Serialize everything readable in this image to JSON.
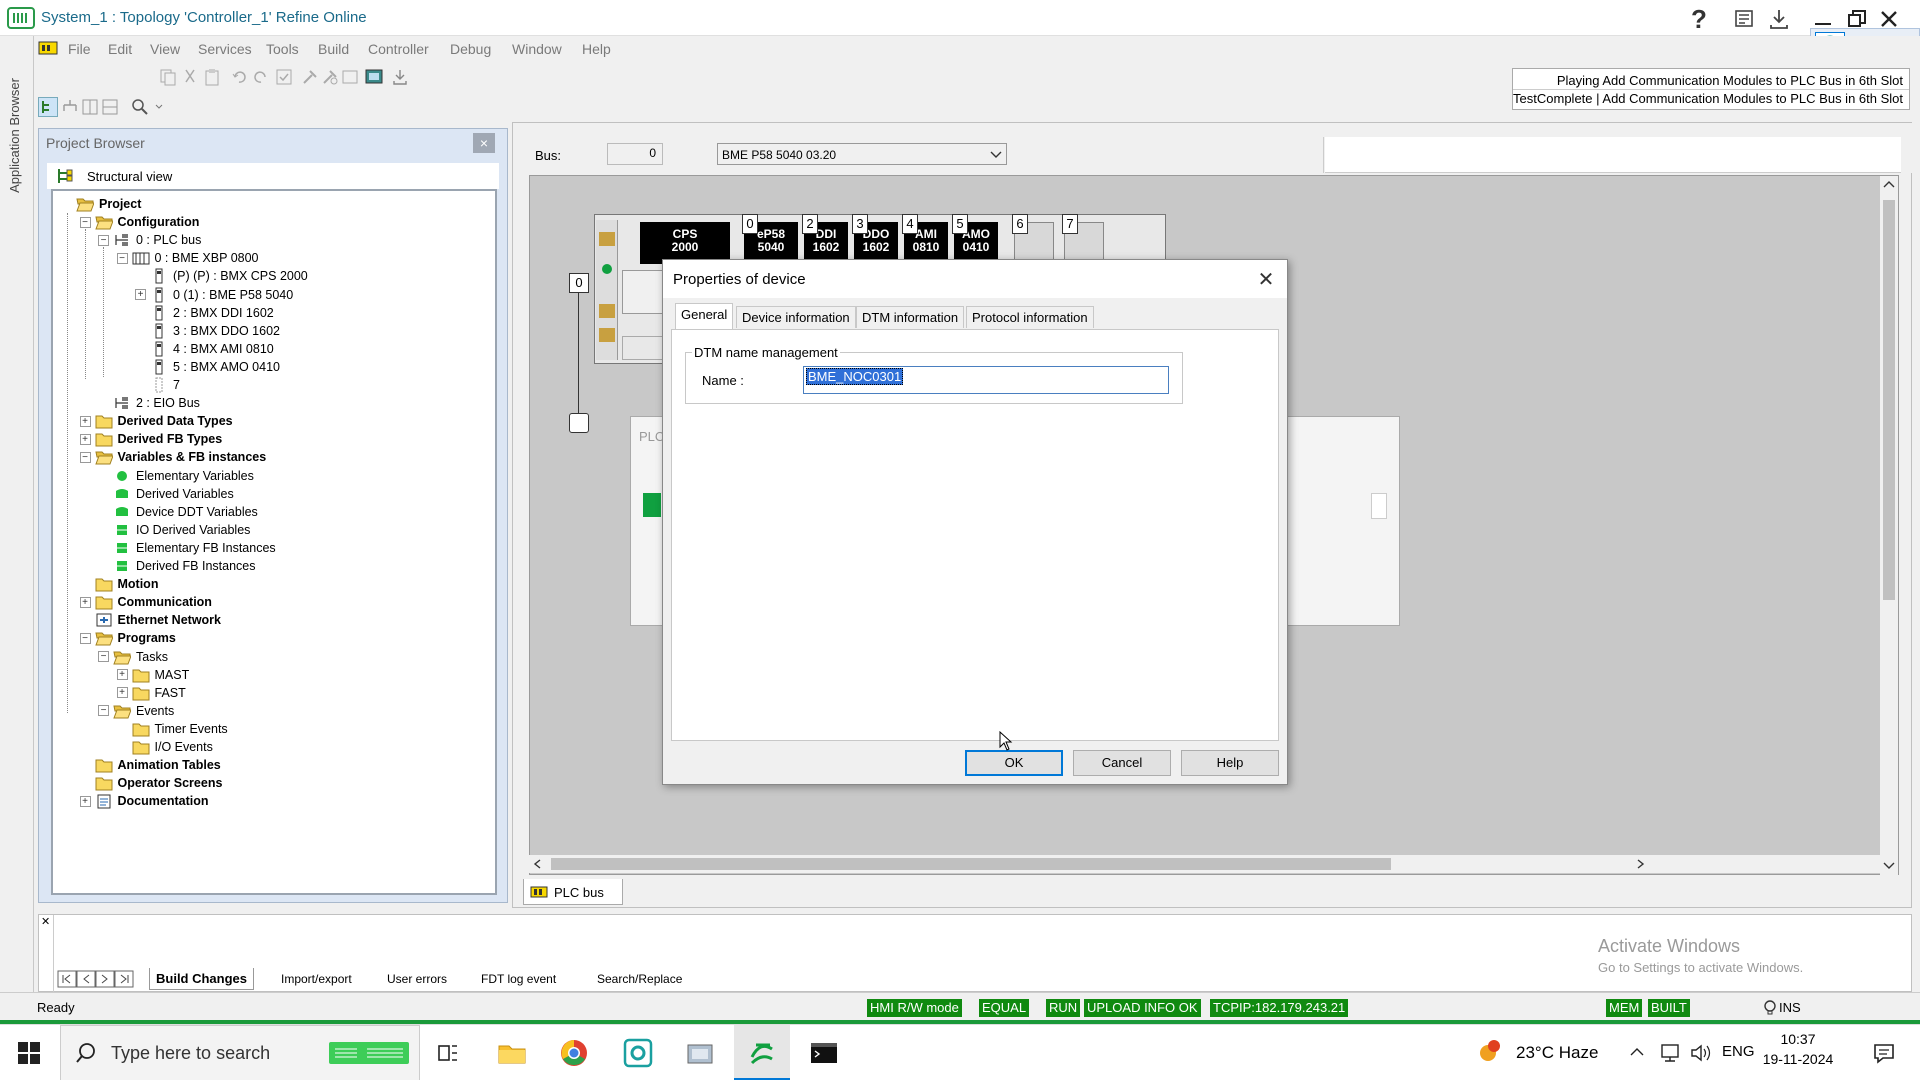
{
  "window": {
    "title": "System_1 : Topology 'Controller_1' Refine Online"
  },
  "app_browser": {
    "label": "Application Browser"
  },
  "menu": [
    "File",
    "Edit",
    "View",
    "Services",
    "Tools",
    "Build",
    "Controller",
    "Debug",
    "Window",
    "Help"
  ],
  "playing_panel": {
    "line1": "Playing Add Communication Modules to PLC Bus in 6th Slot",
    "line2": "TestComplete  |  Add Communication Modules to PLC Bus in 6th Slot"
  },
  "project_browser": {
    "title": "Project Browser",
    "close": "×",
    "view_label": "Structural view",
    "tree": [
      {
        "label": "Project",
        "bold": true,
        "depth": 0,
        "icon": "folder-open-icon"
      },
      {
        "label": "Configuration",
        "bold": true,
        "depth": 1,
        "icon": "folder-open-icon",
        "expander": "−"
      },
      {
        "label": "0 : PLC bus",
        "depth": 2,
        "icon": "bus-icon",
        "expander": "−"
      },
      {
        "label": "0 : BME XBP 0800",
        "depth": 3,
        "icon": "rack-icon",
        "expander": "−"
      },
      {
        "label": "(P) (P) : BMX CPS 2000",
        "depth": 4,
        "icon": "module-icon"
      },
      {
        "label": "0 (1) : BME P58 5040",
        "depth": 4,
        "icon": "module-icon",
        "expander": "+"
      },
      {
        "label": "2 : BMX DDI 1602",
        "depth": 4,
        "icon": "module-icon"
      },
      {
        "label": "3 : BMX DDO 1602",
        "depth": 4,
        "icon": "module-icon"
      },
      {
        "label": "4 : BMX AMI 0810",
        "depth": 4,
        "icon": "module-icon"
      },
      {
        "label": "5 : BMX AMO 0410",
        "depth": 4,
        "icon": "module-icon"
      },
      {
        "label": "7",
        "depth": 4,
        "icon": "empty-slot-icon"
      },
      {
        "label": "2 : EIO Bus",
        "depth": 2,
        "icon": "bus-icon"
      },
      {
        "label": "Derived Data Types",
        "bold": true,
        "depth": 1,
        "icon": "folder-icon",
        "expander": "+"
      },
      {
        "label": "Derived FB Types",
        "bold": true,
        "depth": 1,
        "icon": "folder-icon",
        "expander": "+"
      },
      {
        "label": "Variables & FB instances",
        "bold": true,
        "depth": 1,
        "icon": "folder-open-icon",
        "expander": "−"
      },
      {
        "label": "Elementary Variables",
        "depth": 2,
        "icon": "green-dot-icon"
      },
      {
        "label": "Derived Variables",
        "depth": 2,
        "icon": "green-shape-icon"
      },
      {
        "label": "Device DDT Variables",
        "depth": 2,
        "icon": "green-shape-icon"
      },
      {
        "label": "IO Derived Variables",
        "depth": 2,
        "icon": "green-block-icon"
      },
      {
        "label": "Elementary FB Instances",
        "depth": 2,
        "icon": "green-block-icon"
      },
      {
        "label": "Derived FB Instances",
        "depth": 2,
        "icon": "green-block-icon"
      },
      {
        "label": "Motion",
        "bold": true,
        "depth": 1,
        "icon": "folder-icon"
      },
      {
        "label": "Communication",
        "bold": true,
        "depth": 1,
        "icon": "folder-icon",
        "expander": "+"
      },
      {
        "label": "Ethernet Network",
        "bold": true,
        "depth": 1,
        "icon": "network-icon"
      },
      {
        "label": "Programs",
        "bold": true,
        "depth": 1,
        "icon": "folder-open-icon",
        "expander": "−"
      },
      {
        "label": "Tasks",
        "depth": 2,
        "icon": "folder-open-icon",
        "expander": "−"
      },
      {
        "label": "MAST",
        "depth": 3,
        "icon": "folder-icon",
        "expander": "+"
      },
      {
        "label": "FAST",
        "depth": 3,
        "icon": "folder-icon",
        "expander": "+"
      },
      {
        "label": "Events",
        "depth": 2,
        "icon": "folder-open-icon",
        "expander": "−"
      },
      {
        "label": "Timer Events",
        "depth": 3,
        "icon": "folder-icon"
      },
      {
        "label": "I/O Events",
        "depth": 3,
        "icon": "folder-icon"
      },
      {
        "label": "Animation Tables",
        "bold": true,
        "depth": 1,
        "icon": "folder-icon"
      },
      {
        "label": "Operator Screens",
        "bold": true,
        "depth": 1,
        "icon": "folder-icon"
      },
      {
        "label": "Documentation",
        "bold": true,
        "depth": 1,
        "icon": "documentation-icon",
        "expander": "+"
      }
    ]
  },
  "editor": {
    "bus_label": "Bus:",
    "bus_number": "0",
    "cpu_select": "BME P58 5040   03.20",
    "rack_slot_left": "0",
    "modules": [
      {
        "slot": "",
        "name": "CPS\n2000"
      },
      {
        "slot": "0",
        "name": "eP58\n5040"
      },
      {
        "slot": "2",
        "name": "DDI\n1602"
      },
      {
        "slot": "3",
        "name": "DDO\n1602"
      },
      {
        "slot": "4",
        "name": "AMI\n0810"
      },
      {
        "slot": "5",
        "name": "AMO\n0410"
      },
      {
        "slot": "6",
        "name": ""
      },
      {
        "slot": "7",
        "name": ""
      }
    ],
    "bg_window_label": "PLC",
    "tab_label": "PLC bus"
  },
  "dialog": {
    "title": "Properties of device",
    "close": "✕",
    "tabs": [
      "General",
      "Device information",
      "DTM information",
      "Protocol information"
    ],
    "active_tab": "General",
    "group_title": "DTM name management",
    "name_label": "Name :",
    "name_value": "BME_NOC0301",
    "ok": "OK",
    "cancel": "Cancel",
    "help": "Help"
  },
  "output": {
    "tabs": [
      "Build Changes",
      "Import/export",
      "User errors",
      "FDT log event",
      "Search/Replace"
    ],
    "active_tab": "Build Changes"
  },
  "watermark": {
    "line1": "Activate Windows",
    "line2": "Go to Settings to activate Windows."
  },
  "status": {
    "left": "Ready",
    "hmi": "HMI R/W mode",
    "equal": "EQUAL",
    "run": "RUN",
    "upload": "UPLOAD INFO OK",
    "tcpip": "TCPIP:182.179.243.21",
    "mem": "MEM",
    "built": "BUILT",
    "ins": "INS",
    "accent": "#108a10"
  },
  "taskbar": {
    "search_placeholder": "Type here to search",
    "weather": "23°C  Haze",
    "lang": "ENG",
    "time": "10:37",
    "date": "19-11-2024",
    "weather_badge": "1"
  }
}
